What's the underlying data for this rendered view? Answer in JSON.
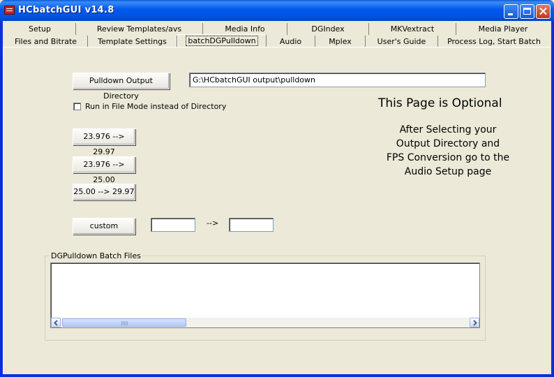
{
  "window": {
    "title": "HCbatchGUI v14.8"
  },
  "tabs_row1": [
    "Setup",
    "Review Templates/avs",
    "Media Info",
    "DGIndex",
    "MKVextract",
    "Media Player"
  ],
  "tabs_row2": [
    "Files and  Bitrate",
    "Template Settings",
    "batchDGPulldown",
    "Audio",
    "Mplex",
    "User's Guide",
    "Process Log, Start Batch"
  ],
  "active_tab": "batchDGPulldown",
  "page": {
    "output_dir_button": "Pulldown Output Directory",
    "output_dir_value": "G:\\HCbatchGUI output\\pulldown",
    "file_mode_label": "Run in File Mode instead of Directory",
    "file_mode_checked": false,
    "conv_buttons": [
      "23.976 --> 29.97",
      "23.976 --> 25.00",
      "25.00 --> 29.97"
    ],
    "custom_button": "custom",
    "custom_from_value": "",
    "custom_arrow": "-->",
    "custom_to_value": "",
    "heading": "This Page is Optional",
    "info_lines": [
      "After Selecting your",
      "Output Directory and",
      "FPS Conversion go to the",
      "Audio Setup page"
    ],
    "group_title": "DGPulldown Batch Files"
  },
  "icons": [
    "app-icon",
    "minimize-icon",
    "maximize-icon",
    "close-icon",
    "scroll-left-icon",
    "scroll-right-icon"
  ]
}
